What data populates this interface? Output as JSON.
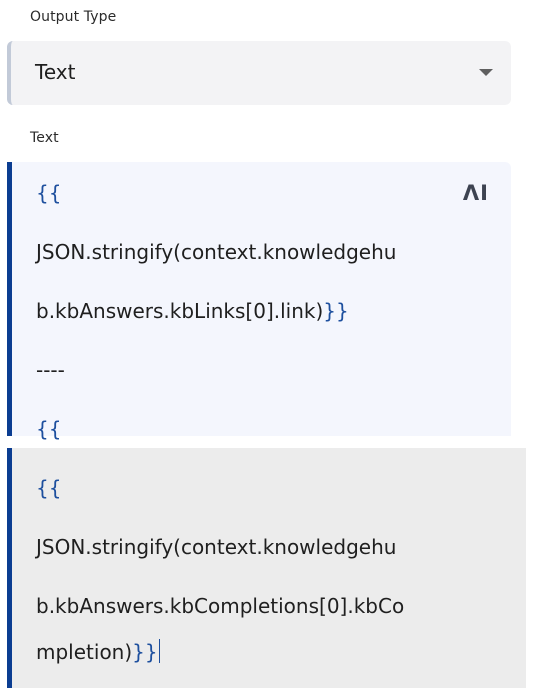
{
  "output_type": {
    "label": "Output Type",
    "selected_value": "Text",
    "arrow_icon": "chevron-down-icon"
  },
  "text_field": {
    "label": "Text",
    "ai_button_label": "ΛI",
    "lines": [
      "{{",
      "JSON.stringify(context.knowledgehu",
      "b.kbAnswers.kbLinks[0].link)",
      "}}",
      "----",
      "{{"
    ]
  },
  "expanded_text": {
    "lines": [
      "{{",
      "JSON.stringify(context.knowledgehu",
      "b.kbAnswers.kbCompletions[0].kbCo",
      "mpletion)",
      "}}"
    ]
  }
}
